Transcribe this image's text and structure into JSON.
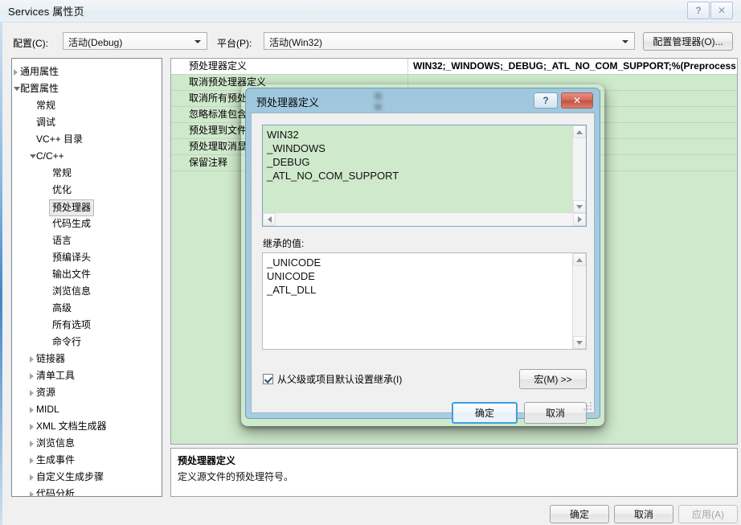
{
  "window": {
    "title": "Services 属性页",
    "help_glyph": "?",
    "close_glyph": "✕"
  },
  "config_bar": {
    "config_label": "配置(C):",
    "config_value": "活动(Debug)",
    "platform_label": "平台(P):",
    "platform_value": "活动(Win32)",
    "config_manager_button": "配置管理器(O)..."
  },
  "tree": {
    "items": [
      {
        "label": "通用属性",
        "indent": 10,
        "arrow": "collapsed",
        "selected": false
      },
      {
        "label": "配置属性",
        "indent": 10,
        "arrow": "expanded",
        "selected": false
      },
      {
        "label": "常规",
        "indent": 30,
        "arrow": "none",
        "selected": false
      },
      {
        "label": "调试",
        "indent": 30,
        "arrow": "none",
        "selected": false
      },
      {
        "label": "VC++ 目录",
        "indent": 30,
        "arrow": "none",
        "selected": false
      },
      {
        "label": "C/C++",
        "indent": 30,
        "arrow": "expanded",
        "selected": false
      },
      {
        "label": "常规",
        "indent": 50,
        "arrow": "none",
        "selected": false
      },
      {
        "label": "优化",
        "indent": 50,
        "arrow": "none",
        "selected": false
      },
      {
        "label": "预处理器",
        "indent": 50,
        "arrow": "none",
        "selected": true
      },
      {
        "label": "代码生成",
        "indent": 50,
        "arrow": "none",
        "selected": false
      },
      {
        "label": "语言",
        "indent": 50,
        "arrow": "none",
        "selected": false
      },
      {
        "label": "预编译头",
        "indent": 50,
        "arrow": "none",
        "selected": false
      },
      {
        "label": "输出文件",
        "indent": 50,
        "arrow": "none",
        "selected": false
      },
      {
        "label": "浏览信息",
        "indent": 50,
        "arrow": "none",
        "selected": false
      },
      {
        "label": "高级",
        "indent": 50,
        "arrow": "none",
        "selected": false
      },
      {
        "label": "所有选项",
        "indent": 50,
        "arrow": "none",
        "selected": false
      },
      {
        "label": "命令行",
        "indent": 50,
        "arrow": "none",
        "selected": false
      },
      {
        "label": "链接器",
        "indent": 30,
        "arrow": "collapsed",
        "selected": false
      },
      {
        "label": "清单工具",
        "indent": 30,
        "arrow": "collapsed",
        "selected": false
      },
      {
        "label": "资源",
        "indent": 30,
        "arrow": "collapsed",
        "selected": false
      },
      {
        "label": "MIDL",
        "indent": 30,
        "arrow": "collapsed",
        "selected": false
      },
      {
        "label": "XML 文档生成器",
        "indent": 30,
        "arrow": "collapsed",
        "selected": false
      },
      {
        "label": "浏览信息",
        "indent": 30,
        "arrow": "collapsed",
        "selected": false
      },
      {
        "label": "生成事件",
        "indent": 30,
        "arrow": "collapsed",
        "selected": false
      },
      {
        "label": "自定义生成步骤",
        "indent": 30,
        "arrow": "collapsed",
        "selected": false
      },
      {
        "label": "代码分析",
        "indent": 30,
        "arrow": "collapsed",
        "selected": false
      }
    ]
  },
  "property_grid": {
    "rows": [
      {
        "name": "预处理器定义",
        "value": "WIN32;_WINDOWS;_DEBUG;_ATL_NO_COM_SUPPORT;%(Preprocess"
      },
      {
        "name": "取消预处理器定义",
        "value": ""
      },
      {
        "name": "取消所有预处理器定义",
        "value": ""
      },
      {
        "name": "忽略标准包含路径",
        "value": ""
      },
      {
        "name": "预处理到文件",
        "value": ""
      },
      {
        "name": "预处理取消显示行号",
        "value": ""
      },
      {
        "name": "保留注释",
        "value": ""
      }
    ]
  },
  "description": {
    "title": "预处理器定义",
    "text": "定义源文件的预处理符号。"
  },
  "footer": {
    "ok": "确定",
    "cancel": "取消",
    "apply": "应用(A)"
  },
  "dialog": {
    "title": "预处理器定义",
    "help_glyph": "?",
    "close_glyph": "✕",
    "values_text": "WIN32\n_WINDOWS\n_DEBUG\n_ATL_NO_COM_SUPPORT",
    "inherited_label": "继承的值:",
    "inherited_text": "_UNICODE\nUNICODE\n_ATL_DLL",
    "inherit_checkbox_label": "从父级或项目默认设置继承(I)",
    "inherit_checked": true,
    "macros_button": "宏(M) >>",
    "ok": "确定",
    "cancel": "取消"
  },
  "colors": {
    "grid_green": "#cfe9cc",
    "dialog_blue": "#a3c9df",
    "default_button_border": "#3c9fe0",
    "close_red": "#c2503f"
  }
}
